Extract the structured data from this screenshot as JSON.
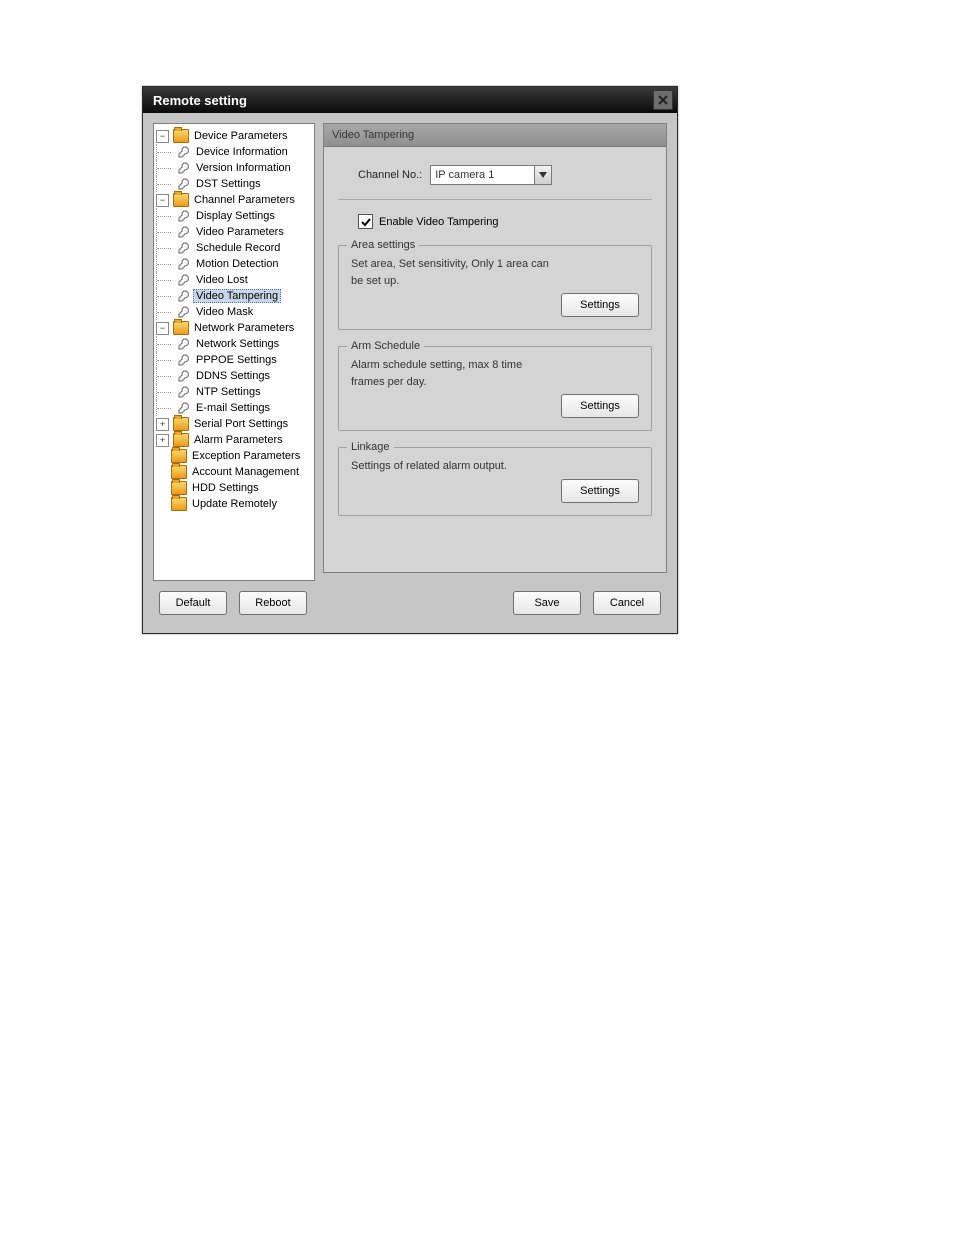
{
  "window": {
    "title": "Remote setting"
  },
  "tree": {
    "device": {
      "label": "Device Parameters",
      "children": {
        "info": "Device Information",
        "version": "Version Information",
        "dst": "DST Settings"
      }
    },
    "channel": {
      "label": "Channel Parameters",
      "children": {
        "display": "Display Settings",
        "video_params": "Video Parameters",
        "schedule": "Schedule Record",
        "motion": "Motion Detection",
        "video_lost": "Video Lost",
        "video_tampering": "Video Tampering",
        "video_mask": "Video Mask"
      }
    },
    "network": {
      "label": "Network Parameters",
      "children": {
        "net": "Network Settings",
        "pppoe": "PPPOE Settings",
        "ddns": "DDNS Settings",
        "ntp": "NTP Settings",
        "email": "E-mail Settings"
      }
    },
    "serial": {
      "label": "Serial Port Settings"
    },
    "alarm": {
      "label": "Alarm Parameters"
    },
    "exception": {
      "label": "Exception Parameters"
    },
    "account": {
      "label": "Account Management"
    },
    "hdd": {
      "label": "HDD Settings"
    },
    "update": {
      "label": "Update Remotely"
    }
  },
  "panel": {
    "header": "Video Tampering",
    "channel_label": "Channel No.:",
    "channel_value": "IP camera 1",
    "enable_label": "Enable Video Tampering",
    "area": {
      "legend": "Area settings",
      "desc": "Set area, Set sensitivity, Only 1 area can be set up.",
      "button": "Settings"
    },
    "arm": {
      "legend": "Arm Schedule",
      "desc": "Alarm schedule setting, max 8 time frames per day.",
      "button": "Settings"
    },
    "linkage": {
      "legend": "Linkage",
      "desc": "Settings of related alarm output.",
      "button": "Settings"
    }
  },
  "footer": {
    "default": "Default",
    "reboot": "Reboot",
    "save": "Save",
    "cancel": "Cancel"
  }
}
